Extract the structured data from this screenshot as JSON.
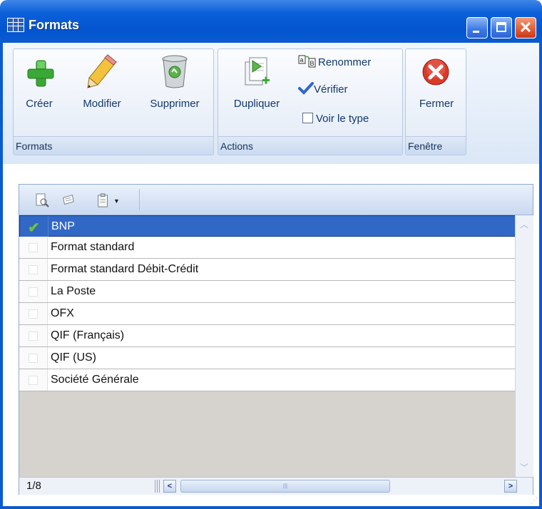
{
  "window": {
    "title": "Formats"
  },
  "ribbon": {
    "groups": [
      {
        "label": "Formats",
        "buttons": [
          "Créer",
          "Modifier",
          "Supprimer"
        ]
      },
      {
        "label": "Actions",
        "buttons": [
          "Dupliquer"
        ],
        "small_buttons": [
          "Renommer",
          "Vérifier",
          "Voir le type"
        ]
      },
      {
        "label": "Fenêtre",
        "buttons": [
          "Fermer"
        ]
      }
    ]
  },
  "list": {
    "rows": [
      {
        "label": "BNP",
        "selected": true,
        "checked": true
      },
      {
        "label": "Format standard",
        "selected": false,
        "checked": false
      },
      {
        "label": "Format standard Débit-Crédit",
        "selected": false,
        "checked": false
      },
      {
        "label": "La Poste",
        "selected": false,
        "checked": false
      },
      {
        "label": "OFX",
        "selected": false,
        "checked": false
      },
      {
        "label": "QIF (Français)",
        "selected": false,
        "checked": false
      },
      {
        "label": "QIF (US)",
        "selected": false,
        "checked": false
      },
      {
        "label": "Société Générale",
        "selected": false,
        "checked": false
      }
    ],
    "status": "1/8"
  },
  "colors": {
    "titlebar": "#0355cf",
    "selection": "#3168c6",
    "accent_green": "#3aa835",
    "close_red": "#d93a2a"
  },
  "icons": [
    "plus-icon",
    "pencil-icon",
    "trash-icon",
    "duplicate-icon",
    "rename-icon",
    "check-icon",
    "close-circle-icon",
    "preview-icon",
    "print-icon",
    "clipboard-icon"
  ]
}
